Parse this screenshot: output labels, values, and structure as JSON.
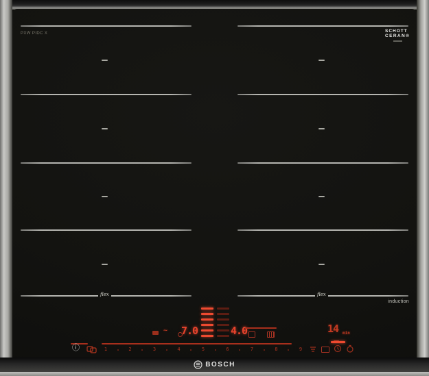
{
  "device": {
    "brand_logo": "BOSCH",
    "model_label": "PXW PIDC X",
    "schott": {
      "line1": "SCHOTT",
      "line2": "CERAN®"
    },
    "flex_script": "flex",
    "induction_label": "induction"
  },
  "display": {
    "left_power": "7.0",
    "right_power": "4.0",
    "timer_value": "14",
    "timer_unit": "min",
    "power_bars": {
      "bright_count": 6,
      "dim_count": 6
    }
  },
  "slider": {
    "numbers": [
      "1",
      "2",
      "3",
      "4",
      "5",
      "6",
      "7",
      "8",
      "9"
    ]
  },
  "icons": {
    "info": "ⓘ",
    "keep_warm_wave": "~"
  },
  "colors": {
    "accent_red": "#e8432c",
    "dim_red": "#a83323",
    "track_red": "#a82f1c",
    "glass": "#131310",
    "zone_line": "#d2d2cd",
    "frame_grey": "#b4b4b2"
  }
}
